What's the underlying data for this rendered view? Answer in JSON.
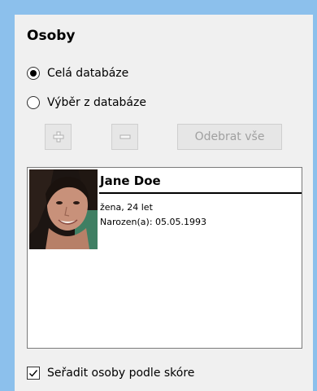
{
  "section": {
    "title": "Osoby"
  },
  "scope": {
    "options": [
      {
        "label": "Celá databáze",
        "checked": true
      },
      {
        "label": "Výběr z databáze",
        "checked": false
      }
    ]
  },
  "toolbar": {
    "add_icon": "plus-icon",
    "remove_icon": "minus-icon",
    "remove_all_label": "Odebrat vše",
    "enabled": false
  },
  "persons": [
    {
      "name": "Jane Doe",
      "gender_age": "žena, 24 let",
      "birth": "Narozen(a): 05.05.1993",
      "photo_icon": "portrait-photo"
    }
  ],
  "options": {
    "sort_by_score_label": "Seřadit osoby podle skóre",
    "sort_by_score_checked": true
  },
  "colors": {
    "window_border": "#8cc0ec",
    "panel_bg": "#f0f0f0",
    "disabled_text": "#a0a0a0"
  }
}
